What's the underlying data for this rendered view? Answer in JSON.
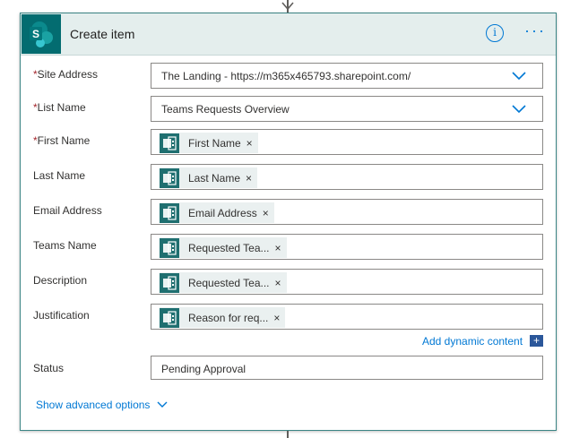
{
  "card": {
    "title": "Create item",
    "info_glyph": "i",
    "more_glyph": "···",
    "icon_name": "sharepoint-icon",
    "header_bg": "#e4eeed",
    "accent": "#036c70"
  },
  "fields": [
    {
      "label": "Site Address",
      "required": true,
      "type": "dropdown",
      "value": "The Landing - https://m365x465793.sharepoint.com/"
    },
    {
      "label": "List Name",
      "required": true,
      "type": "dropdown",
      "value": "Teams Requests Overview"
    },
    {
      "label": "First Name",
      "required": true,
      "type": "token",
      "value": "First Name"
    },
    {
      "label": "Last Name",
      "required": false,
      "type": "token",
      "value": "Last Name"
    },
    {
      "label": "Email Address",
      "required": false,
      "type": "token",
      "value": "Email Address"
    },
    {
      "label": "Teams Name",
      "required": false,
      "type": "token",
      "value": "Requested Tea..."
    },
    {
      "label": "Description",
      "required": false,
      "type": "token",
      "value": "Requested Tea..."
    },
    {
      "label": "Justification",
      "required": false,
      "type": "token",
      "value": "Reason for req..."
    },
    {
      "label": "Status",
      "required": false,
      "type": "text",
      "value": "Pending Approval"
    }
  ],
  "required_marker": "*",
  "token_close": "×",
  "add_dynamic": {
    "label": "Add dynamic content",
    "icon": "+"
  },
  "show_advanced": "Show advanced options"
}
